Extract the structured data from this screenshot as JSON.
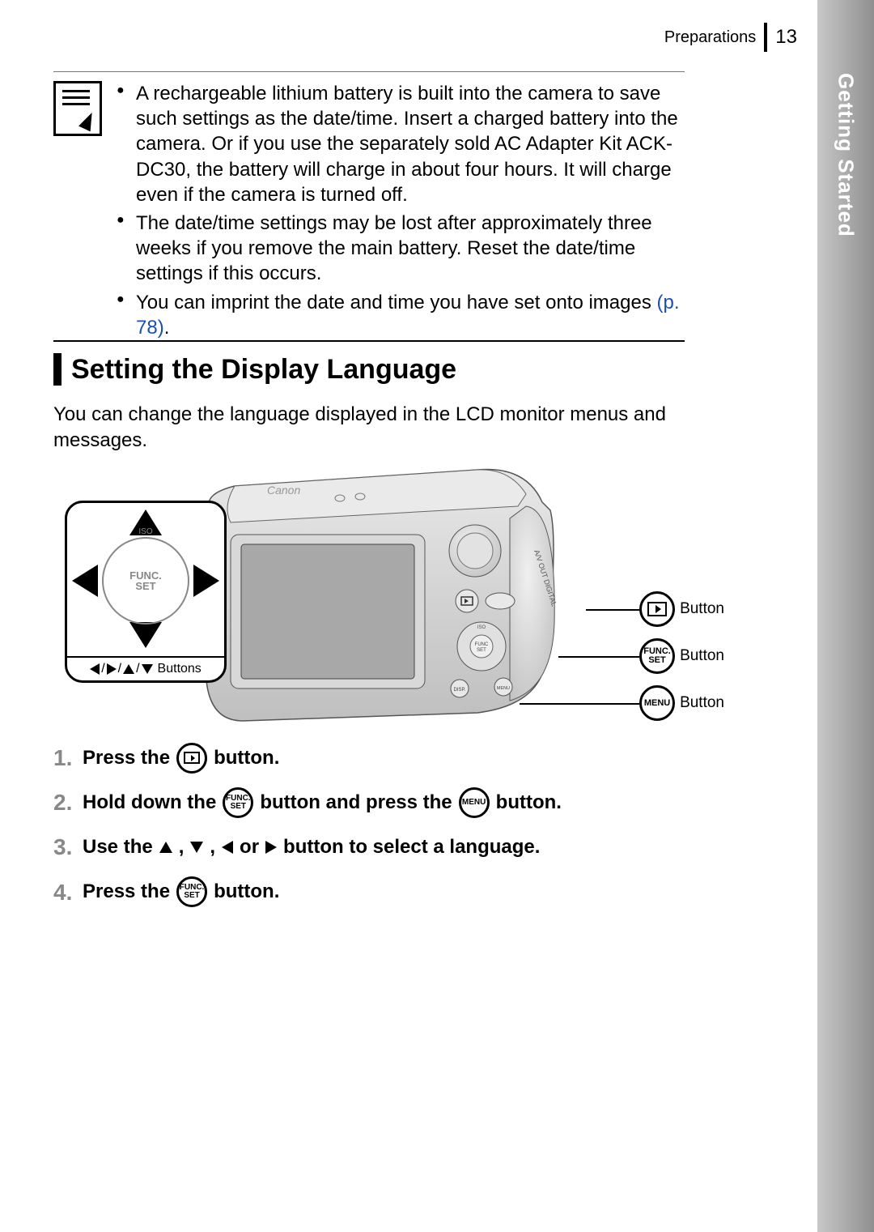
{
  "header": {
    "section": "Preparations",
    "page": "13"
  },
  "side_tab": "Getting Started",
  "note": {
    "bullet1": "A rechargeable lithium battery is built into the camera to save such settings as the date/time. Insert a charged battery into the camera. Or if you use the separately sold AC Adapter Kit ACK-DC30, the battery will charge in about four hours. It will charge even if the camera is turned off.",
    "bullet2": "The date/time settings may be lost after approximately three weeks if you remove the main battery. Reset the date/time settings if this occurs.",
    "bullet3_pre": "You can imprint the date and time you have set onto images ",
    "bullet3_link": "(p. 78)",
    "bullet3_post": "."
  },
  "section_title": "Setting the Display Language",
  "intro": "You can change the language displayed in the LCD monitor menus and messages.",
  "diagram": {
    "dpad_func_top": "FUNC.",
    "dpad_func_bot": "SET",
    "dpad_iso": "ISO",
    "dpad_buttons_label": "Buttons",
    "callout_button": "Button",
    "func_top": "FUNC.",
    "func_bot": "SET",
    "menu": "MENU"
  },
  "steps": {
    "s1_num": "1.",
    "s1_a": "Press the",
    "s1_b": " button.",
    "s2_num": "2.",
    "s2_a": "Hold down the",
    "s2_b": " button and press the ",
    "s2_c": " button.",
    "s3_num": "3.",
    "s3_a": "Use the ",
    "s3_b": " button to select a language.",
    "s3_comma": ", ",
    "s3_or": " or ",
    "s4_num": "4.",
    "s4_a": "Press the",
    "s4_b": " button.",
    "ico_func_top": "FUNC.",
    "ico_func_bot": "SET",
    "ico_menu": "MENU"
  }
}
